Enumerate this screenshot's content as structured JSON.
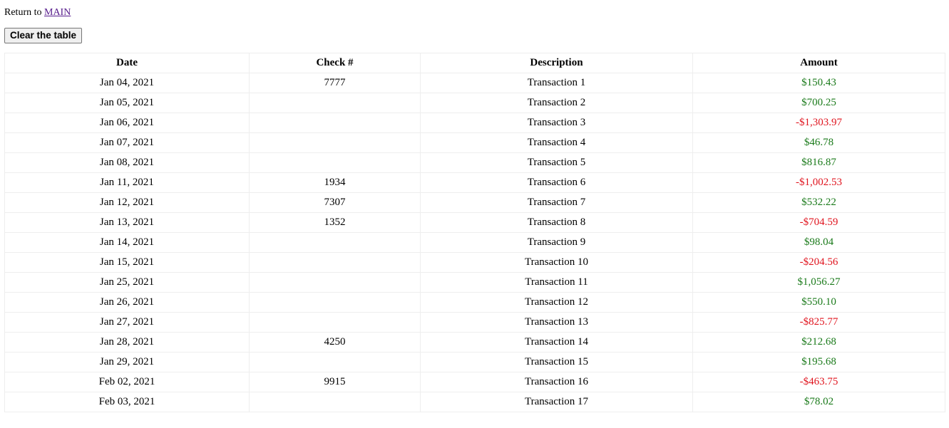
{
  "nav": {
    "return_prefix": "Return to",
    "return_link": "MAIN"
  },
  "toolbar": {
    "clear_label": "Clear the table"
  },
  "colors": {
    "positive": "#1a7a1a",
    "negative": "#e0141e",
    "link": "#551a8b"
  },
  "table": {
    "headers": [
      "Date",
      "Check #",
      "Description",
      "Amount"
    ],
    "rows": [
      {
        "date": "Jan 04, 2021",
        "check": "7777",
        "description": "Transaction 1",
        "amount": "$150.43",
        "sign": "pos"
      },
      {
        "date": "Jan 05, 2021",
        "check": "",
        "description": "Transaction 2",
        "amount": "$700.25",
        "sign": "pos"
      },
      {
        "date": "Jan 06, 2021",
        "check": "",
        "description": "Transaction 3",
        "amount": "-$1,303.97",
        "sign": "neg"
      },
      {
        "date": "Jan 07, 2021",
        "check": "",
        "description": "Transaction 4",
        "amount": "$46.78",
        "sign": "pos"
      },
      {
        "date": "Jan 08, 2021",
        "check": "",
        "description": "Transaction 5",
        "amount": "$816.87",
        "sign": "pos"
      },
      {
        "date": "Jan 11, 2021",
        "check": "1934",
        "description": "Transaction 6",
        "amount": "-$1,002.53",
        "sign": "neg"
      },
      {
        "date": "Jan 12, 2021",
        "check": "7307",
        "description": "Transaction 7",
        "amount": "$532.22",
        "sign": "pos"
      },
      {
        "date": "Jan 13, 2021",
        "check": "1352",
        "description": "Transaction 8",
        "amount": "-$704.59",
        "sign": "neg"
      },
      {
        "date": "Jan 14, 2021",
        "check": "",
        "description": "Transaction 9",
        "amount": "$98.04",
        "sign": "pos"
      },
      {
        "date": "Jan 15, 2021",
        "check": "",
        "description": "Transaction 10",
        "amount": "-$204.56",
        "sign": "neg"
      },
      {
        "date": "Jan 25, 2021",
        "check": "",
        "description": "Transaction 11",
        "amount": "$1,056.27",
        "sign": "pos"
      },
      {
        "date": "Jan 26, 2021",
        "check": "",
        "description": "Transaction 12",
        "amount": "$550.10",
        "sign": "pos"
      },
      {
        "date": "Jan 27, 2021",
        "check": "",
        "description": "Transaction 13",
        "amount": "-$825.77",
        "sign": "neg"
      },
      {
        "date": "Jan 28, 2021",
        "check": "4250",
        "description": "Transaction 14",
        "amount": "$212.68",
        "sign": "pos"
      },
      {
        "date": "Jan 29, 2021",
        "check": "",
        "description": "Transaction 15",
        "amount": "$195.68",
        "sign": "pos"
      },
      {
        "date": "Feb 02, 2021",
        "check": "9915",
        "description": "Transaction 16",
        "amount": "-$463.75",
        "sign": "neg"
      },
      {
        "date": "Feb 03, 2021",
        "check": "",
        "description": "Transaction 17",
        "amount": "$78.02",
        "sign": "pos"
      }
    ]
  }
}
